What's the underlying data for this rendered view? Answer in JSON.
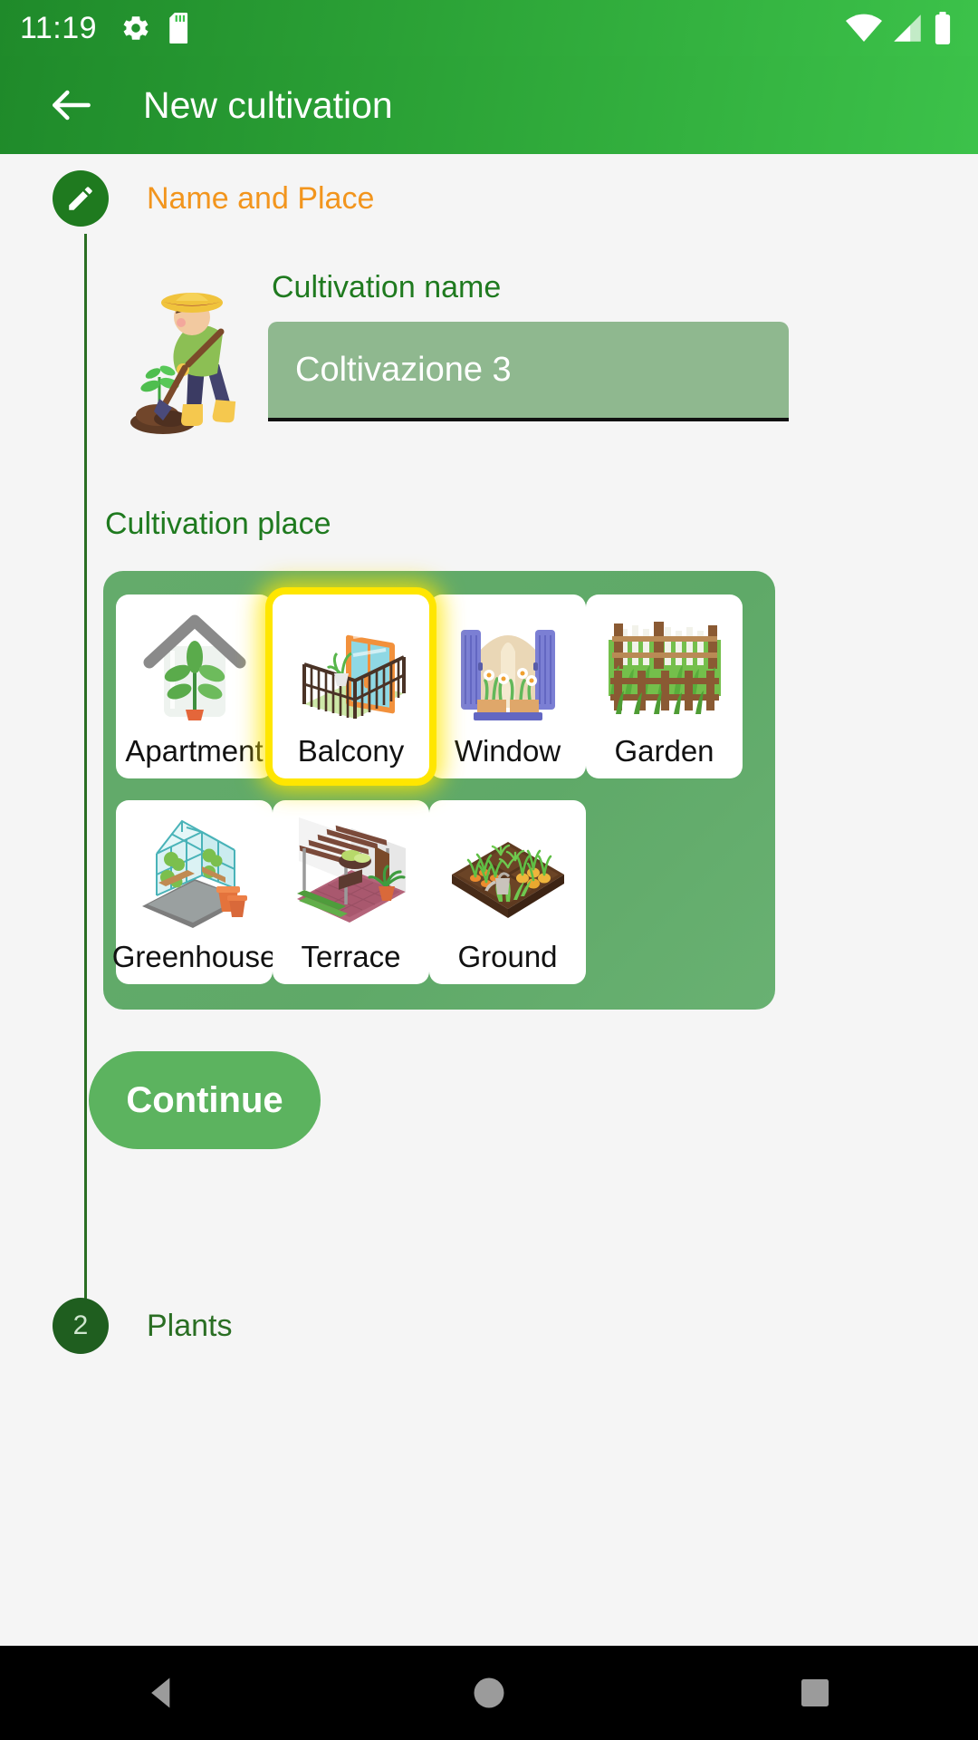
{
  "statusbar": {
    "clock": "11:19",
    "icons": [
      "gear-icon",
      "sd-card-icon"
    ],
    "right_icons": [
      "wifi-icon",
      "cellular-signal-icon",
      "battery-icon"
    ]
  },
  "appbar": {
    "back_label": "back-arrow-icon",
    "title": "New cultivation"
  },
  "step": {
    "badge_icon": "pencil-icon",
    "title": "Name and Place"
  },
  "form": {
    "name_label": "Cultivation name",
    "name_value": "Coltivazione 3",
    "name_placeholder": "Cultivation name",
    "place_label": "Cultivation place"
  },
  "places": [
    {
      "id": "apartment",
      "label": "Apartment",
      "icon": "apartment-icon",
      "selected": false
    },
    {
      "id": "balcony",
      "label": "Balcony",
      "icon": "balcony-icon",
      "selected": true
    },
    {
      "id": "window",
      "label": "Window",
      "icon": "window-icon",
      "selected": false
    },
    {
      "id": "garden",
      "label": "Garden",
      "icon": "garden-icon",
      "selected": false
    },
    {
      "id": "greenhouse",
      "label": "Greenhouse",
      "icon": "greenhouse-icon",
      "selected": false
    },
    {
      "id": "terrace",
      "label": "Terrace",
      "icon": "terrace-icon",
      "selected": false
    },
    {
      "id": "ground",
      "label": "Ground",
      "icon": "ground-icon",
      "selected": false
    }
  ],
  "actions": {
    "continue_label": "Continue"
  },
  "next_step": {
    "number": "2",
    "title": "Plants"
  },
  "navbar": {
    "back": "nav-back-icon",
    "home": "nav-home-icon",
    "recents": "nav-recents-icon"
  },
  "colors": {
    "brand_green": "#2fa93a",
    "dark_green": "#1f7a1f",
    "accent_orange": "#f2951d",
    "field_green": "#8fb88f",
    "panel_green": "#64ab6b",
    "highlight_yellow": "#ffe600",
    "page_bg": "#f5f5f5"
  }
}
